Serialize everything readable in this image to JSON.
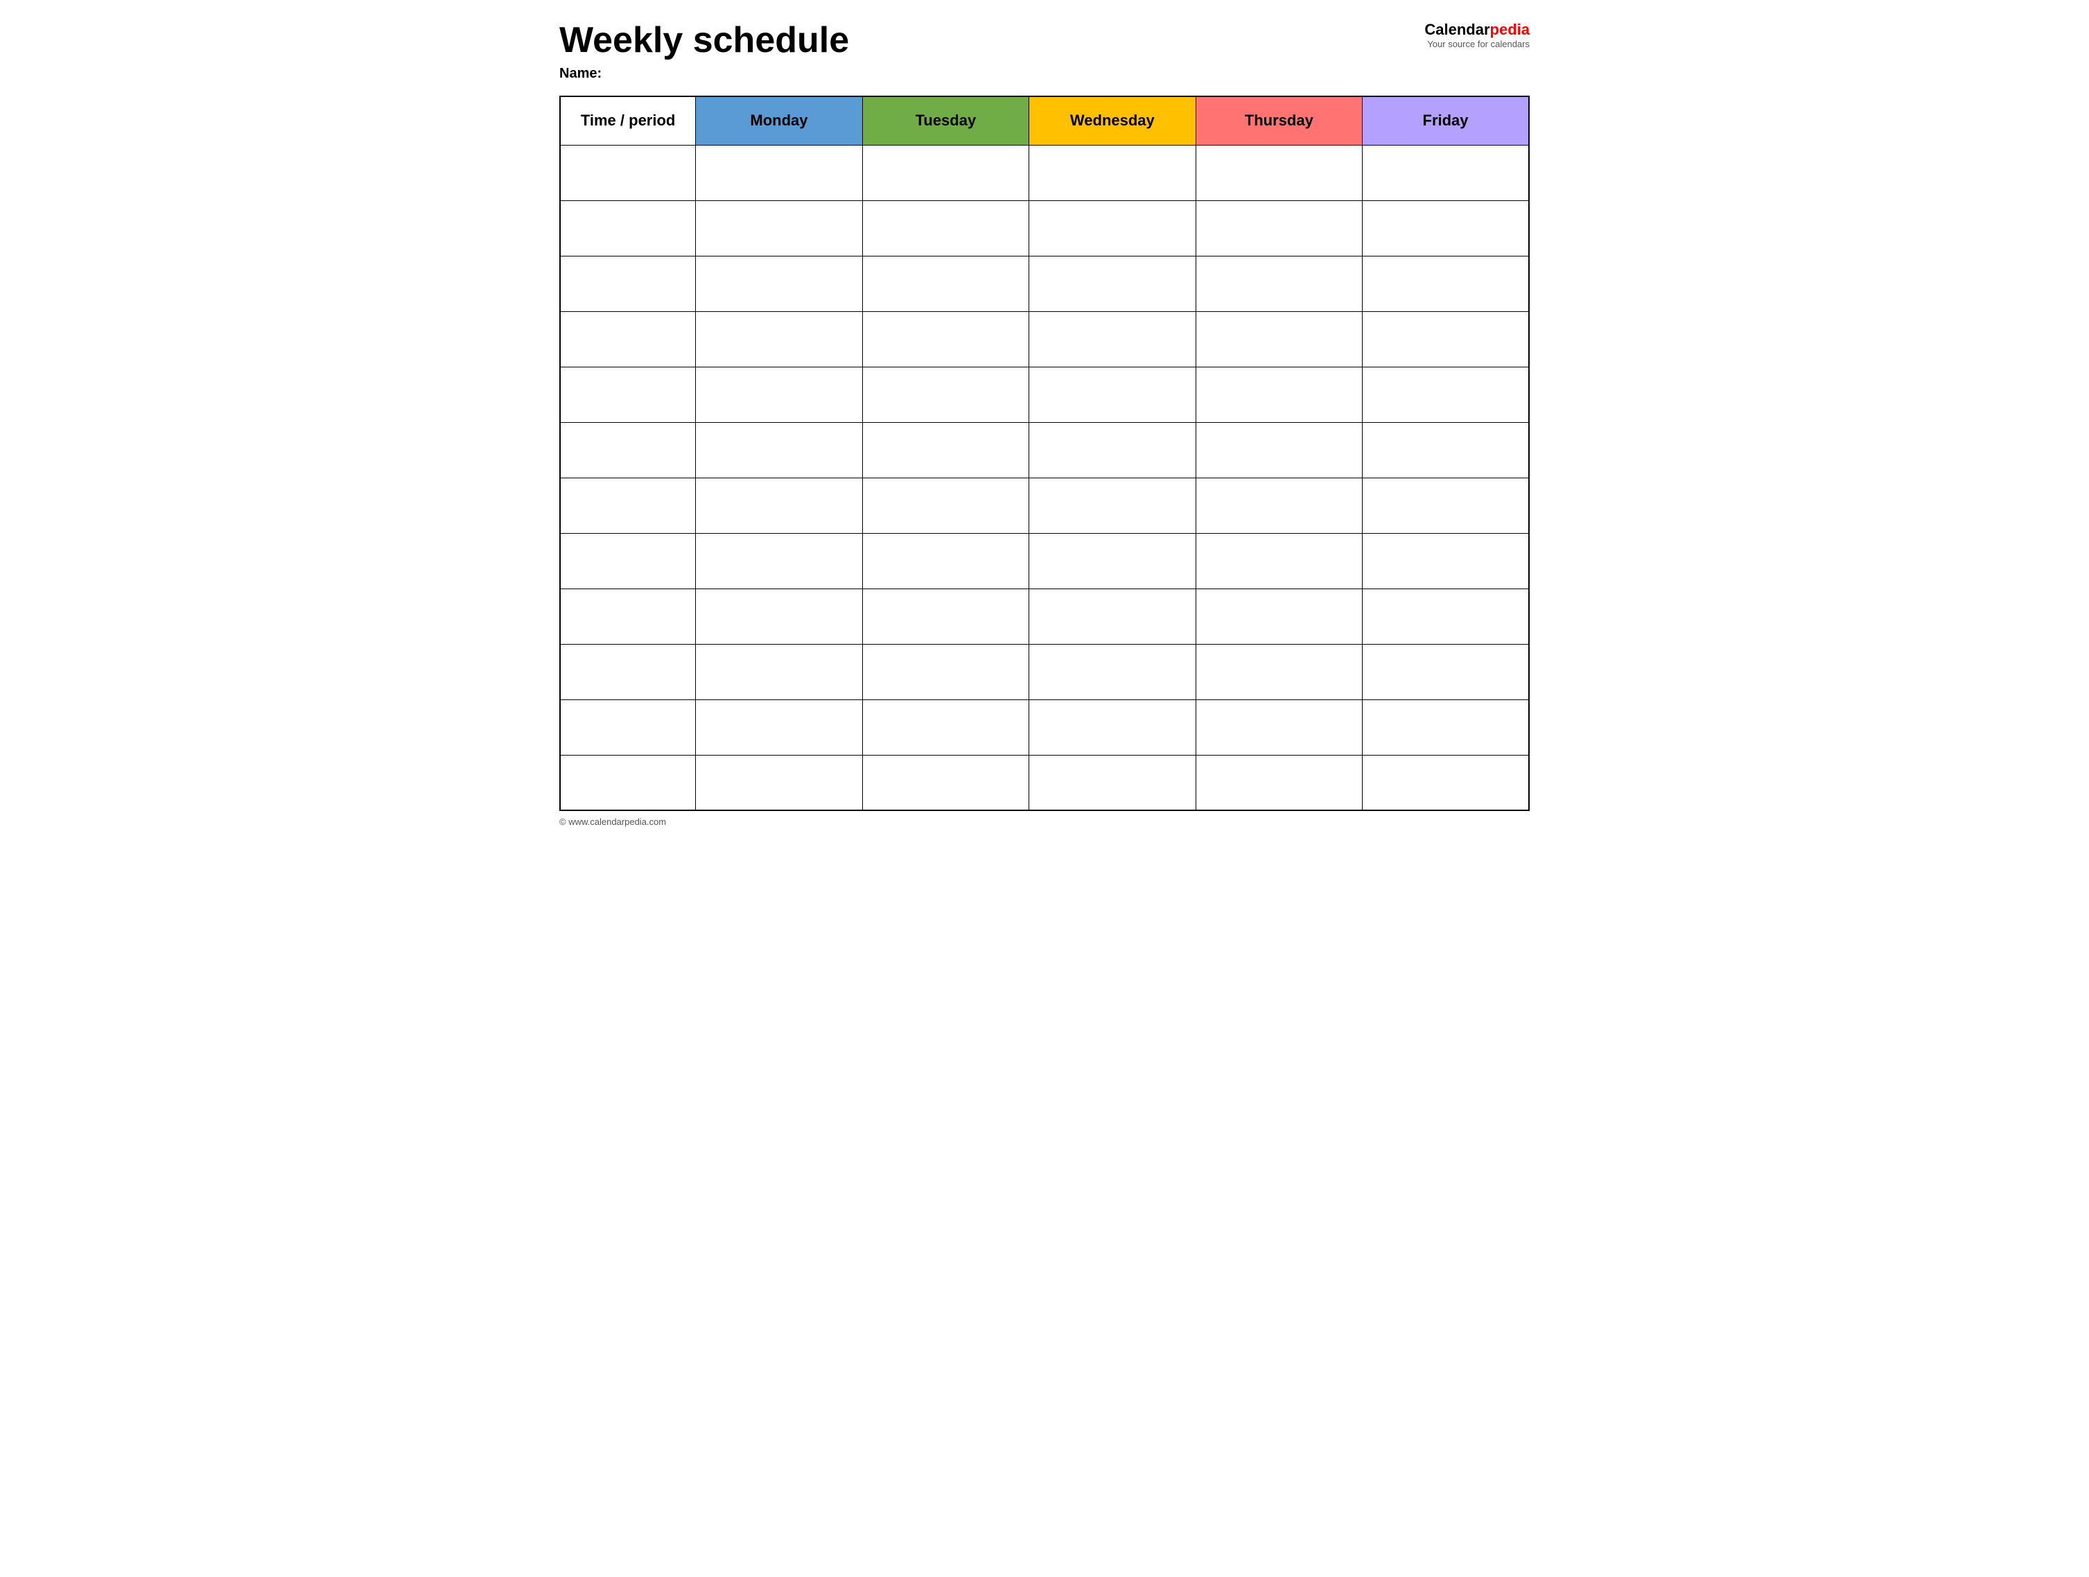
{
  "header": {
    "title": "Weekly schedule",
    "name_label": "Name:",
    "logo_text_calendar": "Calendar",
    "logo_text_pedia": "pedia",
    "logo_tagline": "Your source for calendars"
  },
  "table": {
    "columns": [
      {
        "id": "time",
        "label": "Time / period",
        "color": "#ffffff"
      },
      {
        "id": "monday",
        "label": "Monday",
        "color": "#5b9bd5"
      },
      {
        "id": "tuesday",
        "label": "Tuesday",
        "color": "#70ad47"
      },
      {
        "id": "wednesday",
        "label": "Wednesday",
        "color": "#ffc000"
      },
      {
        "id": "thursday",
        "label": "Thursday",
        "color": "#ff7373"
      },
      {
        "id": "friday",
        "label": "Friday",
        "color": "#b4a0ff"
      }
    ],
    "row_count": 12
  },
  "footer": {
    "copyright": "© www.calendarpedia.com"
  }
}
